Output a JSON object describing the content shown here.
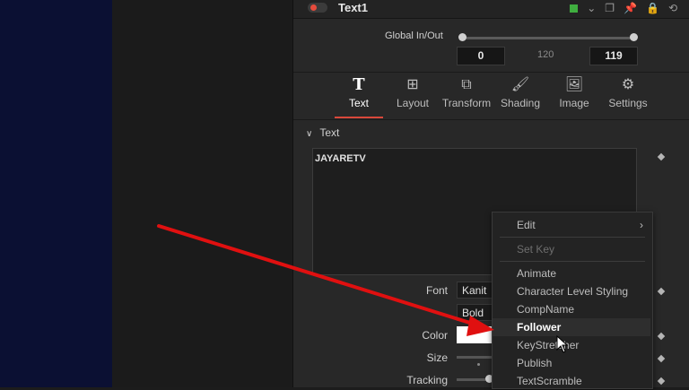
{
  "header": {
    "node_name": "Text1"
  },
  "global": {
    "label": "Global In/Out",
    "in": "0",
    "mid": "120",
    "out": "119"
  },
  "tabs": [
    {
      "label": "Text",
      "icon": "text-T-icon",
      "active": true
    },
    {
      "label": "Layout",
      "icon": "layout-icon"
    },
    {
      "label": "Transform",
      "icon": "transform-icon"
    },
    {
      "label": "Shading",
      "icon": "shading-brush-icon"
    },
    {
      "label": "Image",
      "icon": "image-icon"
    },
    {
      "label": "Settings",
      "icon": "settings-icon"
    }
  ],
  "section": {
    "title": "Text"
  },
  "styled_text": "JAYARETV",
  "props": {
    "font_label": "Font",
    "font_value": "Kanit",
    "style_value": "Bold",
    "color_label": "Color",
    "color_value": "#ffffff",
    "size_label": "Size",
    "tracking_label": "Tracking"
  },
  "menu": {
    "items": [
      {
        "label": "Edit",
        "submenu": true
      },
      {
        "label": "Set Key",
        "disabled": true
      },
      {
        "label": "Animate"
      },
      {
        "label": "Character Level Styling"
      },
      {
        "label": "CompName"
      },
      {
        "label": "Follower",
        "hover": true
      },
      {
        "label": "KeyStretcher"
      },
      {
        "label": "Publish"
      },
      {
        "label": "TextScramble"
      }
    ]
  },
  "colors": {
    "accent": "#d9483b",
    "panel": "#282828",
    "viewer": "#0b1033",
    "annotation_arrow": "#e01010"
  }
}
